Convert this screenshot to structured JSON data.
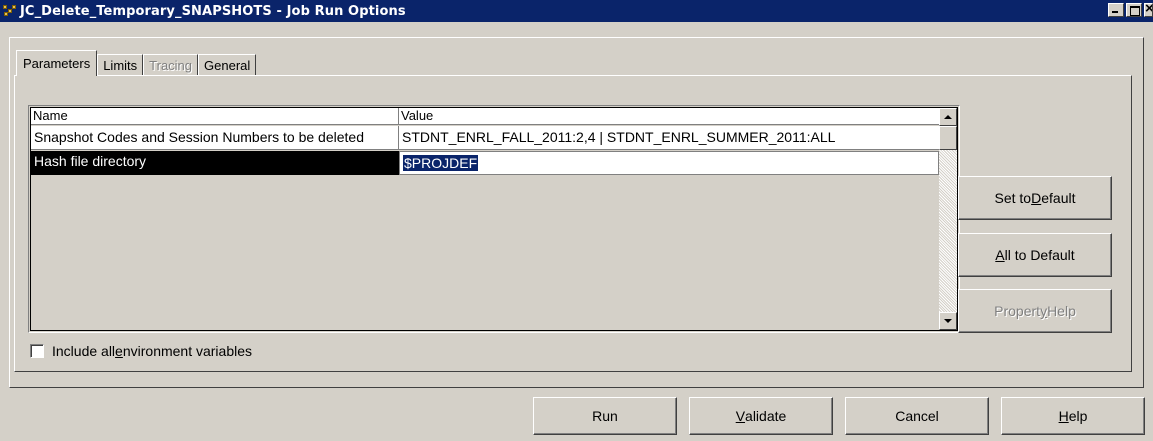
{
  "window": {
    "title": "JC_Delete_Temporary_SNAPSHOTS - Job Run Options"
  },
  "tabs": [
    {
      "label": "Parameters",
      "state": "active"
    },
    {
      "label": "Limits",
      "state": "normal"
    },
    {
      "label": "Tracing",
      "state": "disabled"
    },
    {
      "label": "General",
      "state": "normal"
    }
  ],
  "grid": {
    "columns": [
      "Name",
      "Value"
    ],
    "rows": [
      {
        "name": "Snapshot Codes and Session Numbers to be deleted",
        "value": "STDNT_ENRL_FALL_2011:2,4 | STDNT_ENRL_SUMMER_2011:ALL"
      },
      {
        "name": "Hash file directory",
        "value": "$PROJDEF",
        "selected": true
      }
    ]
  },
  "side_buttons": {
    "set_default": {
      "pre": "Set to ",
      "key": "D",
      "post": "efault"
    },
    "all_default": {
      "pre": "",
      "key": "A",
      "post": "ll to Default"
    },
    "property_help": {
      "pre": "Propert",
      "key": "y",
      "post": " Help",
      "disabled": true
    }
  },
  "checkbox": {
    "pre": "Include all ",
    "key": "e",
    "post": "nvironment variables",
    "checked": false
  },
  "bottom_buttons": {
    "run": {
      "pre": "Run",
      "key": "",
      "post": ""
    },
    "validate": {
      "pre": "",
      "key": "V",
      "post": "alidate"
    },
    "cancel": {
      "pre": "Cancel",
      "key": "",
      "post": ""
    },
    "help": {
      "pre": "",
      "key": "H",
      "post": "elp"
    }
  },
  "colors": {
    "titlebar": "#0a246a",
    "face": "#d4d0c8",
    "selection": "#0a246a"
  }
}
